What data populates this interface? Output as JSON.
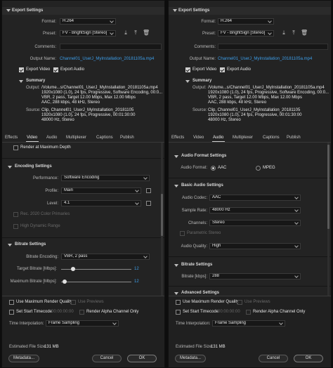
{
  "left": {
    "export_settings": {
      "header": "Export Settings",
      "format_label": "Format:",
      "format_value": "H.264",
      "preset_label": "Preset:",
      "preset_value": "FV - BrightSign [Stereo]",
      "comments_label": "Comments:",
      "output_name_label": "Output Name:",
      "output_name_value": "Channel01_UserJ_MyInstallation_20181105a.mp4",
      "export_video_label": "Export Video",
      "export_audio_label": "Export Audio",
      "export_video_checked": true,
      "export_audio_checked": true
    },
    "summary": {
      "header": "Summary",
      "output_label": "Output:",
      "output_lines": [
        "/Volume...s/Channel01_UserJ_MyInstallation_20181105a.mp4",
        "1920x1080 (1.0), 24 fps, Progressive, Software Encoding, 00:0...",
        "VBR, 2 pass, Target 12.00 Mbps, Max 12.00 Mbps",
        "AAC, 288 kbps, 48 kHz, Stereo"
      ],
      "source_label": "Source:",
      "source_lines": [
        "Clip, Channel01_UserJ_MyInstallation_20181105",
        "1920x1080 (1.0), 24 fps, Progressive, 00:01:30:00",
        "48000 Hz, Stereo"
      ]
    },
    "tabs": [
      "Effects",
      "Video",
      "Audio",
      "Multiplexer",
      "Captions",
      "Publish"
    ],
    "active_tab": "Video",
    "render_max_depth_label": "Render at Maximum Depth",
    "encoding": {
      "header": "Encoding Settings",
      "performance_label": "Performance:",
      "performance_value": "Software Encoding",
      "profile_label": "Profile:",
      "profile_value": "Main",
      "level_label": "Level:",
      "level_value": "4.1",
      "rec2020_label": "Rec. 2020 Color Primaries",
      "hdr_label": "High Dynamic Range"
    },
    "bitrate": {
      "header": "Bitrate Settings",
      "encoding_label": "Bitrate Encoding:",
      "encoding_value": "VBR, 2 pass",
      "target_label": "Target Bitrate [Mbps]:",
      "target_value": "12",
      "target_fraction": 0.17,
      "max_label": "Maximum Bitrate [Mbps]:",
      "max_value": "12",
      "max_fraction": 0.05
    }
  },
  "right": {
    "export_settings": {
      "header": "Export Settings",
      "format_label": "Format:",
      "format_value": "H.264",
      "preset_label": "Preset:",
      "preset_value": "FV - BrightSign [Stereo]",
      "comments_label": "Comments:",
      "output_name_label": "Output Name:",
      "output_name_value": "Channel01_UserJ_MyInstallation_20181105a.mp4",
      "export_video_label": "Export Video",
      "export_audio_label": "Export Audio",
      "export_video_checked": true,
      "export_audio_checked": true
    },
    "summary": {
      "header": "Summary",
      "output_label": "Output:",
      "output_lines": [
        "/Volume...s/Channel01_UserJ_MyInstallation_20181105a.mp4",
        "1920x1080 (1.0), 24 fps, Progressive, Software Encoding, 00:0...",
        "VBR, 2 pass, Target 12.00 Mbps, Max 12.00 Mbps",
        "AAC, 288 kbps, 48 kHz, Stereo"
      ],
      "source_label": "Source:",
      "source_lines": [
        "Clip, Channel01_UserJ_MyInstallation_20181105",
        "1920x1080 (1.0), 24 fps, Progressive, 00:01:30:00",
        "48000 Hz, Stereo"
      ]
    },
    "tabs": [
      "Effects",
      "Video",
      "Audio",
      "Multiplexer",
      "Captions",
      "Publish"
    ],
    "active_tab": "Audio",
    "audio_format": {
      "header": "Audio Format Settings",
      "format_label": "Audio Format:",
      "aac_label": "AAC",
      "mpeg_label": "MPEG"
    },
    "basic_audio": {
      "header": "Basic Audio Settings",
      "codec_label": "Audio Codec:",
      "codec_value": "AAC",
      "sample_rate_label": "Sample Rate:",
      "sample_rate_value": "48000 Hz",
      "channels_label": "Channels:",
      "channels_value": "Stereo",
      "parametric_label": "Parametric Stereo",
      "quality_label": "Audio Quality:",
      "quality_value": "High"
    },
    "bitrate": {
      "header": "Bitrate Settings",
      "label": "Bitrate [kbps]:",
      "value": "288"
    },
    "advanced": {
      "header": "Advanced Settings"
    }
  },
  "footer": {
    "use_max_render_quality": "Use Maximum Render Quality",
    "use_previews": "Use Previews",
    "set_start_timecode": "Set Start Timecode",
    "timecode_value": "00:00:00:00",
    "render_alpha": "Render Alpha Channel Only",
    "time_interp_label": "Time Interpolation:",
    "time_interp_value": "Frame Sampling",
    "file_size_label": "Estimated File Size:",
    "file_size_value": "131 MB",
    "metadata_button": "Metadata...",
    "cancel_button": "Cancel",
    "ok_button": "OK"
  },
  "colors": {
    "accent_blue": "#3d9ee9",
    "panel_bg": "#232323",
    "field_bg": "#171717"
  },
  "icons": [
    "chevron-down-icon",
    "import-preset-icon",
    "save-preset-icon",
    "delete-preset-icon",
    "disclosure-triangle-icon",
    "checkbox-icon",
    "radio-icon"
  ]
}
